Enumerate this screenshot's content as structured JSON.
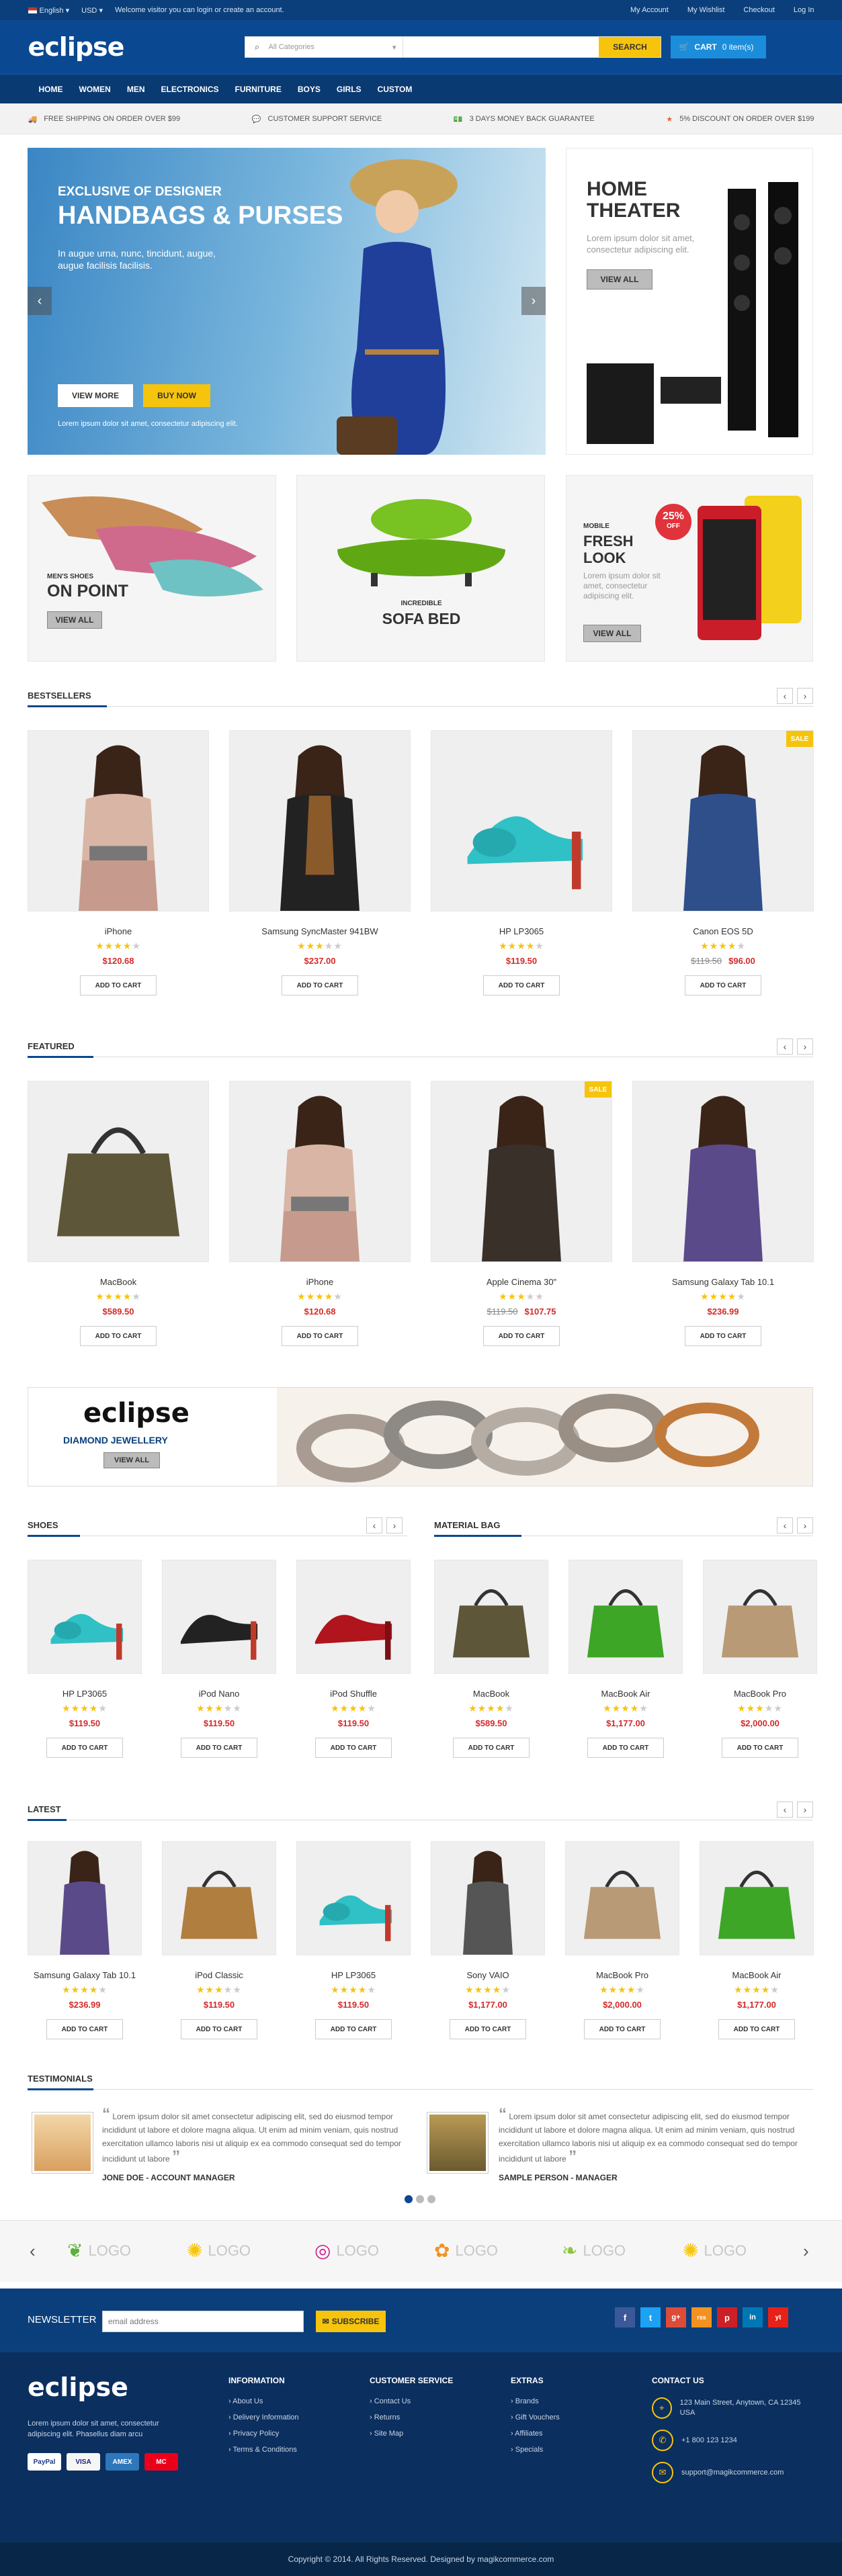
{
  "topbar": {
    "language": "English",
    "currency": "USD",
    "welcome": "Welcome visitor you can login or create an account.",
    "links": [
      "My Account",
      "My Wishlist",
      "Checkout",
      "Log In"
    ]
  },
  "header": {
    "logo": "eclipse",
    "search_category": "All Categories",
    "search_placeholder": "",
    "search_button": "SEARCH",
    "cart_label": "CART",
    "cart_count": "0 item(s)"
  },
  "nav": [
    "HOME",
    "WOMEN",
    "MEN",
    "ELECTRONICS",
    "FURNITURE",
    "BOYS",
    "GIRLS",
    "CUSTOM"
  ],
  "features": [
    "FREE SHIPPING ON ORDER OVER $99",
    "CUSTOMER SUPPORT SERVICE",
    "3 DAYS MONEY BACK GUARANTEE",
    "5% DISCOUNT ON ORDER OVER $199"
  ],
  "slider": {
    "kicker": "EXCLUSIVE OF DESIGNER",
    "title": "HANDBAGS & PURSES",
    "text": "In augue urna, nunc, tincidunt, augue, augue facilisis facilisis.",
    "btn_more": "VIEW MORE",
    "btn_buy": "BUY NOW",
    "footnote": "Lorem ipsum dolor sit amet, consectetur adipiscing elit."
  },
  "promo_theater": {
    "title": "HOME THEATER",
    "text": "Lorem ipsum dolor sit amet, consectetur adipiscing elit.",
    "button": "VIEW ALL"
  },
  "promo_shoes": {
    "kicker": "MEN'S SHOES",
    "title": "ON POINT",
    "button": "VIEW ALL"
  },
  "promo_sofa": {
    "kicker": "INCREDIBLE",
    "title": "SOFA BED"
  },
  "promo_mobile": {
    "kicker": "MOBILE",
    "title1": "FRESH",
    "title2": "LOOK",
    "text": "Lorem ipsum dolor sit amet, consectetur adipiscing elit.",
    "badge": "25%",
    "badge2": "OFF",
    "button": "VIEW ALL"
  },
  "bestsellers": {
    "title": "BESTSELLERS",
    "items": [
      {
        "name": "iPhone",
        "rating": 4,
        "price": "$120.68",
        "old": "",
        "sale": false,
        "img": "woman"
      },
      {
        "name": "Samsung SyncMaster 941BW",
        "rating": 3,
        "price": "$237.00",
        "old": "",
        "sale": false,
        "img": "woman-scarf"
      },
      {
        "name": "HP LP3065",
        "rating": 4,
        "price": "$119.50",
        "old": "",
        "sale": false,
        "img": "shoe"
      },
      {
        "name": "Canon EOS 5D",
        "rating": 4,
        "price": "$96.00",
        "old": "$119.50",
        "sale": true,
        "img": "jacket"
      }
    ]
  },
  "featured": {
    "title": "FEATURED",
    "items": [
      {
        "name": "MacBook",
        "rating": 4,
        "price": "$589.50",
        "old": "",
        "sale": false,
        "img": "bag"
      },
      {
        "name": "iPhone",
        "rating": 4,
        "price": "$120.68",
        "old": "",
        "sale": false,
        "img": "woman"
      },
      {
        "name": "Apple Cinema 30\"",
        "rating": 3,
        "price": "$107.75",
        "old": "$119.50",
        "sale": true,
        "img": "jacket2"
      },
      {
        "name": "Samsung Galaxy Tab 10.1",
        "rating": 4,
        "price": "$236.99",
        "old": "",
        "sale": false,
        "img": "plaid"
      }
    ]
  },
  "jewellery": {
    "logo": "eclipse",
    "title": "DIAMOND JEWELLERY",
    "button": "VIEW ALL"
  },
  "shoes": {
    "title": "SHOES",
    "items": [
      {
        "name": "HP LP3065",
        "rating": 4,
        "price": "$119.50",
        "img": "shoe"
      },
      {
        "name": "iPod Nano",
        "rating": 3,
        "price": "$119.50",
        "img": "heel-black"
      },
      {
        "name": "iPod Shuffle",
        "rating": 4,
        "price": "$119.50",
        "img": "heel-red"
      }
    ]
  },
  "bags": {
    "title": "MATERIAL BAG",
    "items": [
      {
        "name": "MacBook",
        "rating": 4,
        "price": "$589.50",
        "img": "bag"
      },
      {
        "name": "MacBook Air",
        "rating": 4,
        "price": "$1,177.00",
        "img": "bag-green"
      },
      {
        "name": "MacBook Pro",
        "rating": 3,
        "price": "$2,000.00",
        "img": "bag-tan"
      }
    ]
  },
  "latest": {
    "title": "LATEST",
    "items": [
      {
        "name": "Samsung Galaxy Tab 10.1",
        "rating": 4,
        "price": "$236.99",
        "img": "plaid"
      },
      {
        "name": "iPod Classic",
        "rating": 3,
        "price": "$119.50",
        "img": "bag-brown"
      },
      {
        "name": "HP LP3065",
        "rating": 4,
        "price": "$119.50",
        "img": "shoe"
      },
      {
        "name": "Sony VAIO",
        "rating": 4,
        "price": "$1,177.00",
        "img": "woman-grey"
      },
      {
        "name": "MacBook Pro",
        "rating": 4,
        "price": "$2,000.00",
        "img": "bag-tan"
      },
      {
        "name": "MacBook Air",
        "rating": 4,
        "price": "$1,177.00",
        "img": "bag-green"
      }
    ]
  },
  "add_to_cart": "ADD TO CART",
  "testimonials": {
    "title": "TESTIMONIALS",
    "items": [
      {
        "text": "Lorem ipsum dolor sit amet consectetur adipiscing elit, sed do eiusmod tempor incididunt ut labore et dolore magna aliqua. Ut enim ad minim veniam, quis nostrud exercitation ullamco laboris nisi ut aliquip ex ea commodo consequat sed do tempor incididunt ut labore",
        "author": "JONE DOE - ACCOUNT MANAGER"
      },
      {
        "text": "Lorem ipsum dolor sit amet consectetur adipiscing elit, sed do eiusmod tempor incididunt ut labore et dolore magna aliqua. Ut enim ad minim veniam, quis nostrud exercitation ullamco laboris nisi ut aliquip ex ea commodo consequat sed do tempor incididunt ut labore",
        "author": "SAMPLE PERSON - MANAGER"
      }
    ]
  },
  "brands": [
    "LOGO",
    "LOGO",
    "LOGO",
    "LOGO",
    "LOGO",
    "LOGO"
  ],
  "newsletter": {
    "label": "NEWSLETTER",
    "placeholder": "email address",
    "button": "SUBSCRIBE",
    "social": [
      "f",
      "t",
      "g+",
      "rss",
      "p",
      "in",
      "yt"
    ]
  },
  "footer": {
    "logo": "eclipse",
    "about": "Lorem ipsum dolor sit amet, consectetur adipiscing elit. Phasellus diam arcu",
    "payments": [
      "PayPal",
      "VISA",
      "AMEX",
      "MC"
    ],
    "cols": [
      {
        "title": "INFORMATION",
        "links": [
          "About Us",
          "Delivery Information",
          "Privacy Policy",
          "Terms & Conditions"
        ]
      },
      {
        "title": "CUSTOMER SERVICE",
        "links": [
          "Contact Us",
          "Returns",
          "Site Map"
        ]
      },
      {
        "title": "EXTRAS",
        "links": [
          "Brands",
          "Gift Vouchers",
          "Affiliates",
          "Specials"
        ]
      }
    ],
    "contact_title": "CONTACT US",
    "address": "123 Main Street, Anytown, CA 12345 USA",
    "phone": "+1 800 123 1234",
    "email": "support@magikcommerce.com"
  },
  "copyright": "Copyright © 2014. All Rights Reserved. Designed by magikcommerce.com",
  "colors": {
    "primary": "#0a4891",
    "accent": "#f6c40c",
    "price": "#d42b2b"
  }
}
